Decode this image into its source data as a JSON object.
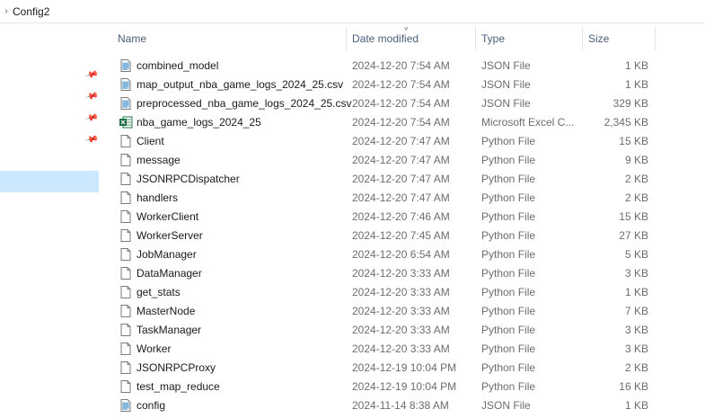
{
  "breadcrumb": {
    "chevron": "chevron-right-icon",
    "folder": "Config2"
  },
  "nav": {
    "pins": [
      "pin-icon",
      "pin-icon",
      "pin-icon",
      "pin-icon"
    ]
  },
  "columns": {
    "name": "Name",
    "date": "Date modified",
    "type": "Type",
    "size": "Size"
  },
  "files": [
    {
      "name": "combined_model",
      "date": "2024-12-20 7:54 AM",
      "type": "JSON File",
      "size": "1 KB",
      "icon": "json"
    },
    {
      "name": "map_output_nba_game_logs_2024_25.csv",
      "date": "2024-12-20 7:54 AM",
      "type": "JSON File",
      "size": "1 KB",
      "icon": "json"
    },
    {
      "name": "preprocessed_nba_game_logs_2024_25.csv",
      "date": "2024-12-20 7:54 AM",
      "type": "JSON File",
      "size": "329 KB",
      "icon": "json"
    },
    {
      "name": "nba_game_logs_2024_25",
      "date": "2024-12-20 7:54 AM",
      "type": "Microsoft Excel C...",
      "size": "2,345 KB",
      "icon": "excel"
    },
    {
      "name": "Client",
      "date": "2024-12-20 7:47 AM",
      "type": "Python File",
      "size": "15 KB",
      "icon": "file"
    },
    {
      "name": "message",
      "date": "2024-12-20 7:47 AM",
      "type": "Python File",
      "size": "9 KB",
      "icon": "file"
    },
    {
      "name": "JSONRPCDispatcher",
      "date": "2024-12-20 7:47 AM",
      "type": "Python File",
      "size": "2 KB",
      "icon": "file"
    },
    {
      "name": "handlers",
      "date": "2024-12-20 7:47 AM",
      "type": "Python File",
      "size": "2 KB",
      "icon": "file"
    },
    {
      "name": "WorkerClient",
      "date": "2024-12-20 7:46 AM",
      "type": "Python File",
      "size": "15 KB",
      "icon": "file"
    },
    {
      "name": "WorkerServer",
      "date": "2024-12-20 7:45 AM",
      "type": "Python File",
      "size": "27 KB",
      "icon": "file"
    },
    {
      "name": "JobManager",
      "date": "2024-12-20 6:54 AM",
      "type": "Python File",
      "size": "5 KB",
      "icon": "file"
    },
    {
      "name": "DataManager",
      "date": "2024-12-20 3:33 AM",
      "type": "Python File",
      "size": "3 KB",
      "icon": "file"
    },
    {
      "name": "get_stats",
      "date": "2024-12-20 3:33 AM",
      "type": "Python File",
      "size": "1 KB",
      "icon": "file"
    },
    {
      "name": "MasterNode",
      "date": "2024-12-20 3:33 AM",
      "type": "Python File",
      "size": "7 KB",
      "icon": "file"
    },
    {
      "name": "TaskManager",
      "date": "2024-12-20 3:33 AM",
      "type": "Python File",
      "size": "3 KB",
      "icon": "file"
    },
    {
      "name": "Worker",
      "date": "2024-12-20 3:33 AM",
      "type": "Python File",
      "size": "3 KB",
      "icon": "file"
    },
    {
      "name": "JSONRPCProxy",
      "date": "2024-12-19 10:04 PM",
      "type": "Python File",
      "size": "2 KB",
      "icon": "file"
    },
    {
      "name": "test_map_reduce",
      "date": "2024-12-19 10:04 PM",
      "type": "Python File",
      "size": "16 KB",
      "icon": "file"
    },
    {
      "name": "config",
      "date": "2024-11-14 8:38 AM",
      "type": "JSON File",
      "size": "1 KB",
      "icon": "json"
    }
  ]
}
